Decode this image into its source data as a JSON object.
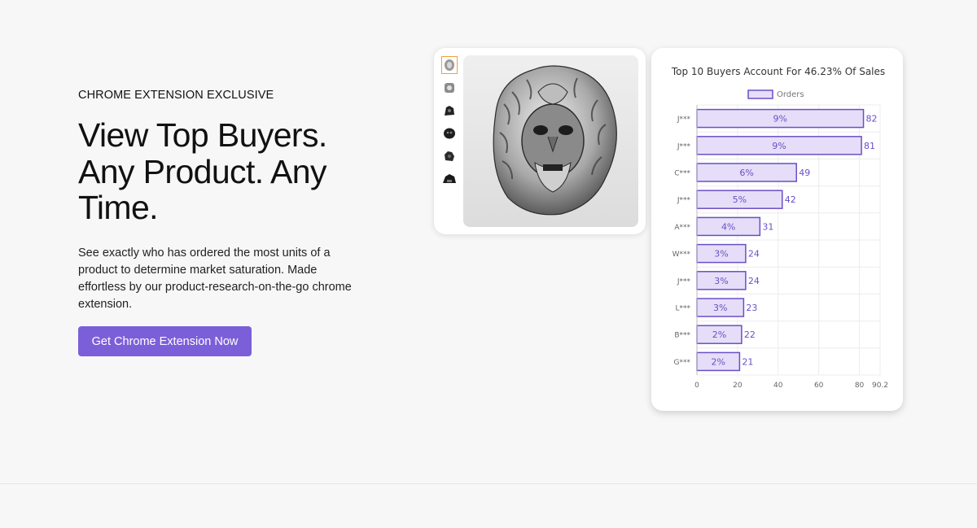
{
  "hero": {
    "eyebrow": "CHROME EXTENSION EXCLUSIVE",
    "headline_lines": [
      "View Top Buyers.",
      "Any Product. Any",
      "Time."
    ],
    "description": "See exactly who has ordered the most units of a product to determine market saturation. Made effortless by our product-research-on-the-go chrome extension.",
    "cta_label": "Get Chrome Extension Now"
  },
  "product": {
    "thumbnails": [
      "ring-thumbnail-1",
      "ring-thumbnail-2",
      "ring-thumbnail-3",
      "ring-thumbnail-4",
      "ring-thumbnail-5",
      "ring-thumbnail-6"
    ],
    "selected_thumbnail": 0,
    "accent_color": "#f0a040"
  },
  "chart_data": {
    "type": "bar",
    "orientation": "horizontal",
    "title": "Top 10 Buyers Account For 46.23% Of Sales",
    "legend": "Orders",
    "legend_position": "top",
    "categories": [
      "J***",
      "J***",
      "C***",
      "J***",
      "A***",
      "W***",
      "J***",
      "L***",
      "B***",
      "G***"
    ],
    "values": [
      82,
      81,
      49,
      42,
      31,
      24,
      24,
      23,
      22,
      21
    ],
    "bar_labels": [
      "9%",
      "9%",
      "6%",
      "5%",
      "4%",
      "3%",
      "3%",
      "3%",
      "2%",
      "2%"
    ],
    "xlim": [
      0,
      90.2
    ],
    "x_ticks": [
      "0",
      "20",
      "40",
      "60",
      "80",
      "90.2"
    ],
    "x_tick_values": [
      0,
      20,
      40,
      60,
      80,
      90.2
    ],
    "grid": true,
    "bar_fill": "#e6def8",
    "bar_stroke": "#6a4fc6",
    "label_color": "#6a4fc6"
  }
}
